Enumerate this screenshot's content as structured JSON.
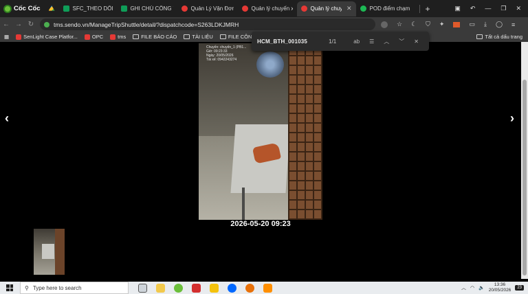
{
  "browser": {
    "brand": "Cốc Cốc",
    "tabs": [
      {
        "label": "",
        "icon": "drive-icon"
      },
      {
        "label": "SFC_THEO DÕI ĐỐI",
        "icon": "sheets-icon"
      },
      {
        "label": "GHI CHÚ CÔNG VIỆ",
        "icon": "sheets-icon"
      },
      {
        "label": "Quản Lý Vận Đơn C",
        "icon": "sendo-icon"
      },
      {
        "label": "Quản lý chuyến xe",
        "icon": "sendo-icon"
      },
      {
        "label": "Quản lý chuyế",
        "icon": "sendo-icon",
        "active": true
      },
      {
        "label": "POD điểm chạm",
        "icon": "pod-icon"
      }
    ],
    "url": "tms.sendo.vn/ManageTripShuttle/detail/?dispatchcode=S263LDKJMRH"
  },
  "bookmarks": {
    "items": [
      "SenLight Case Platfor...",
      "OPC",
      "tms",
      "FILE BÁO CÁO",
      "TÀI LIỆU",
      "FILE CÔNG VIỆC"
    ],
    "all": "Tất cả dấu trang"
  },
  "find": {
    "query": "HCM_BTH_001035",
    "count": "1/1",
    "ab": "ab"
  },
  "photo": {
    "overlay": [
      "Chuyến: chuyến_1 (PB1...",
      "Giờ: 09:23:33",
      "Ngày: 20/05/2026",
      "Tài xế: 0942243274"
    ],
    "caption": "2026-05-20 09:23"
  },
  "nav": {
    "prev": "‹",
    "next": "›"
  },
  "taskbar": {
    "search_placeholder": "Type here to search",
    "time": "13:36",
    "date": "20/05/2026",
    "notifications": "23"
  },
  "colors": {
    "accent": "#6bbf3a",
    "sendo": "#e53935",
    "sheets": "#0f9d58"
  }
}
